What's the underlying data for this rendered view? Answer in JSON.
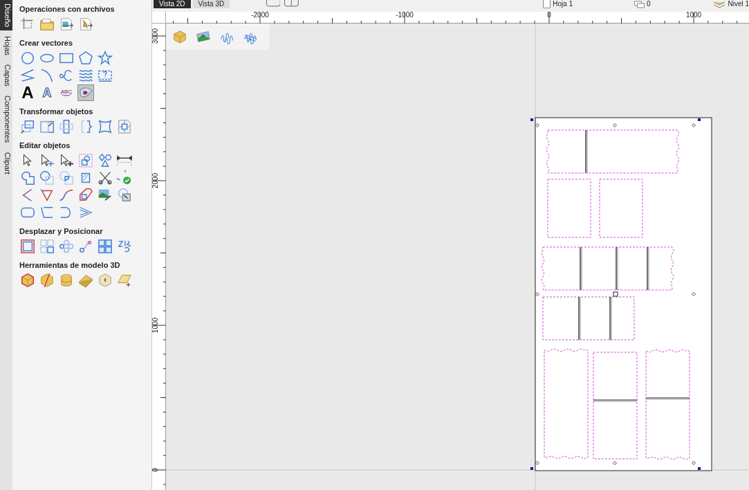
{
  "side_tabs": [
    {
      "label": "Diseño",
      "selected": true
    },
    {
      "label": "Hojas",
      "selected": false
    },
    {
      "label": "Capas",
      "selected": false
    },
    {
      "label": "Componentes",
      "selected": false
    },
    {
      "label": "Clipart",
      "selected": false
    }
  ],
  "tool_sections": [
    {
      "title": "Operaciones con archivos",
      "rows": [
        [
          {
            "selected": false
          },
          {
            "selected": false
          },
          {
            "selected": false
          },
          {
            "selected": false
          }
        ]
      ]
    },
    {
      "title": "Crear vectores",
      "rows": [
        [
          {
            "selected": false
          },
          {
            "selected": false
          },
          {
            "selected": false
          },
          {
            "selected": false
          },
          {
            "selected": false
          }
        ],
        [
          {
            "selected": false
          },
          {
            "selected": false
          },
          {
            "selected": false
          },
          {
            "selected": false
          },
          {
            "selected": false
          }
        ],
        [
          {
            "selected": false,
            "glyph": "A"
          },
          {
            "selected": false,
            "glyph": "A"
          },
          {
            "selected": false,
            "glyph": "ABC"
          },
          {
            "selected": true
          }
        ]
      ]
    },
    {
      "title": "Transformar objetos",
      "rows": [
        [
          {
            "selected": false
          },
          {
            "selected": false
          },
          {
            "selected": false
          },
          {
            "selected": false
          },
          {
            "selected": false
          },
          {
            "selected": false
          }
        ]
      ]
    },
    {
      "title": "Editar objetos",
      "rows": [
        [
          {
            "selected": false
          },
          {
            "selected": false
          },
          {
            "selected": false
          },
          {
            "selected": false
          },
          {
            "selected": false
          },
          {
            "selected": false
          }
        ],
        [
          {
            "selected": false
          },
          {
            "selected": false
          },
          {
            "selected": false
          },
          {
            "selected": false
          },
          {
            "selected": false
          },
          {
            "selected": false
          }
        ],
        [
          {
            "selected": false
          },
          {
            "selected": false
          },
          {
            "selected": false
          },
          {
            "selected": false
          },
          {
            "selected": false
          },
          {
            "selected": false
          }
        ],
        [
          {
            "selected": false
          },
          {
            "selected": false
          },
          {
            "selected": false
          },
          {
            "selected": false
          }
        ]
      ]
    },
    {
      "title": "Desplazar y Posicionar",
      "rows": [
        [
          {
            "selected": false
          },
          {
            "selected": false
          },
          {
            "selected": false
          },
          {
            "selected": false
          },
          {
            "selected": false
          },
          {
            "selected": false
          }
        ]
      ]
    },
    {
      "title": "Herramientas de modelo 3D",
      "rows": [
        [
          {
            "selected": false
          },
          {
            "selected": false
          },
          {
            "selected": false
          },
          {
            "selected": false
          },
          {
            "selected": false
          },
          {
            "selected": false
          }
        ]
      ]
    }
  ],
  "view_tabs": [
    {
      "label": "Vista 2D",
      "selected": true
    },
    {
      "label": "Vista 3D",
      "selected": false
    }
  ],
  "sheet": "Hoja 1",
  "copies": "0",
  "layer": "Nivel 1",
  "rulers": {
    "horizontal": [
      "-2000",
      "-1000",
      "0",
      "1000"
    ],
    "vertical": [
      "3000",
      "2000",
      "1000",
      "0"
    ]
  }
}
